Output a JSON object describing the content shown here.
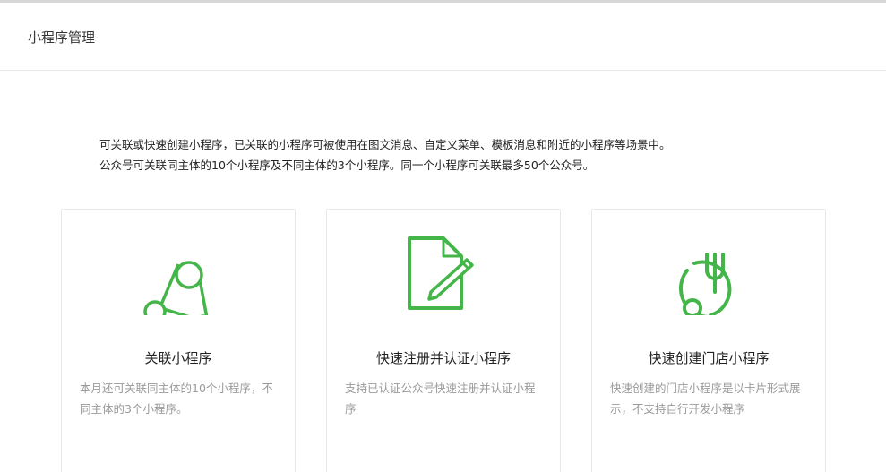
{
  "header": {
    "title": "小程序管理"
  },
  "intro": {
    "line1": "可关联或快速创建小程序，已关联的小程序可被使用在图文消息、自定义菜单、模板消息和附近的小程序等场景中。",
    "line2": "公众号可关联同主体的10个小程序及不同主体的3个小程序。同一个小程序可关联最多50个公众号。"
  },
  "cards": [
    {
      "icon": "link-nodes-icon",
      "title": "关联小程序",
      "desc": "本月还可关联同主体的10个小程序，不同主体的3个小程序。"
    },
    {
      "icon": "document-edit-icon",
      "title": "快速注册并认证小程序",
      "desc": "支持已认证公众号快速注册并认证小程序"
    },
    {
      "icon": "store-fork-icon",
      "title": "快速创建门店小程序",
      "desc": "快速创建的门店小程序是以卡片形式展示，不支持自行开发小程序"
    }
  ],
  "colors": {
    "accent": "#44b549",
    "border": "#e7e7e7",
    "muted": "#9a9a9a"
  }
}
